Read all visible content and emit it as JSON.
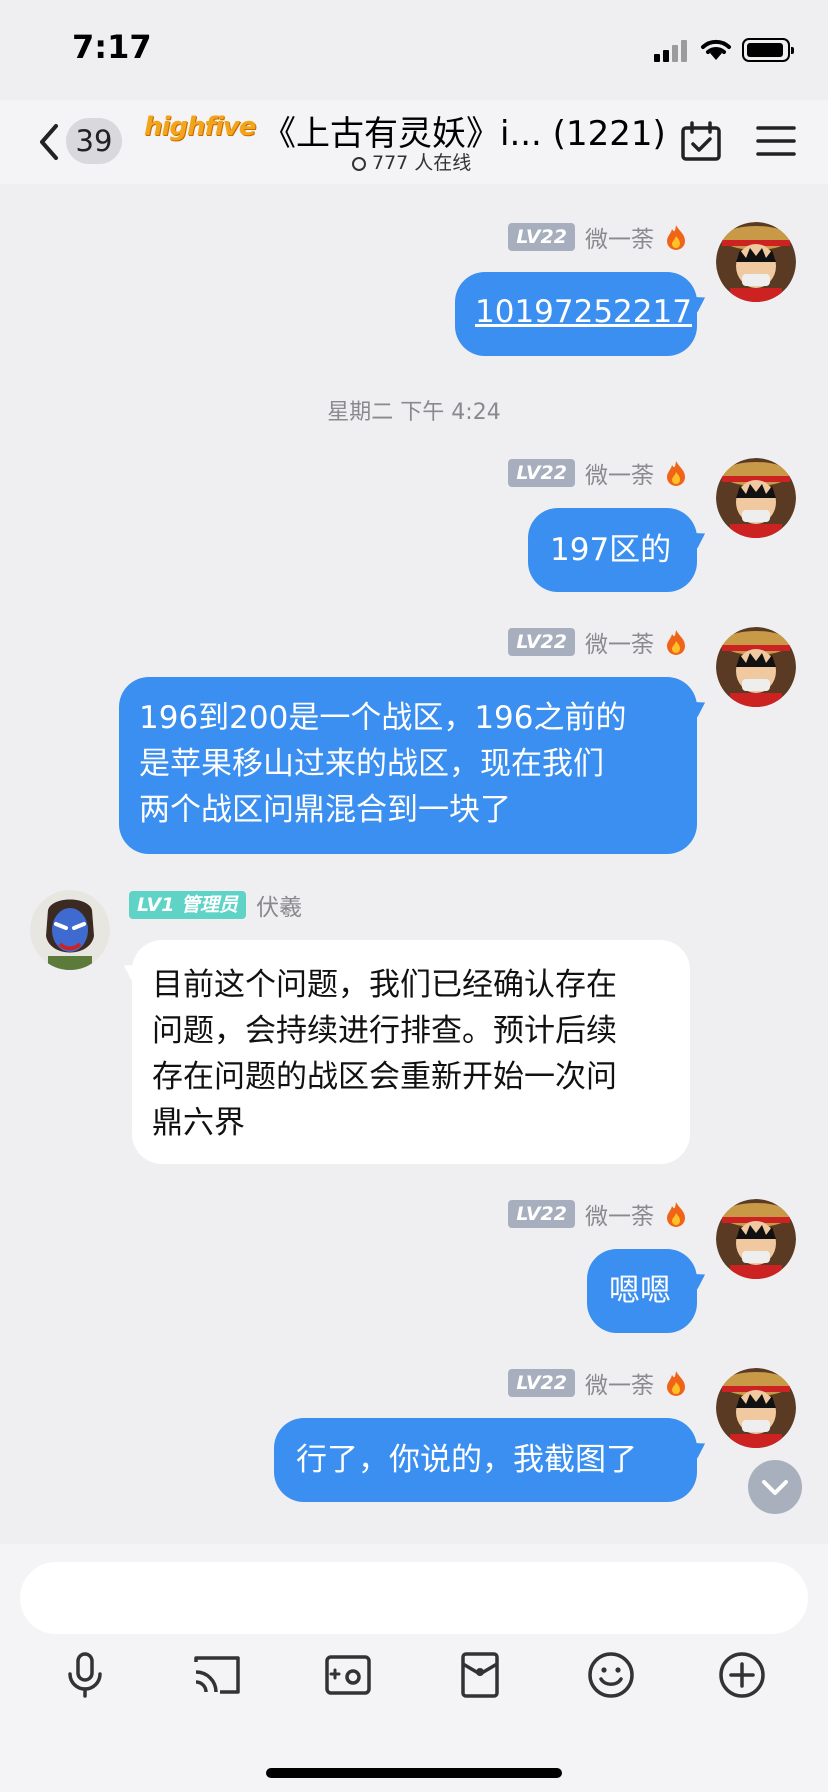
{
  "status_bar": {
    "time": "7:17"
  },
  "header": {
    "back_count": "39",
    "logo_text": "highfive",
    "title": "《上古有灵妖》i... (1221)",
    "online": "777 人在线"
  },
  "timestamp": "星期二 下午 4:24",
  "messages": [
    {
      "level": "LV22",
      "name": "微一荼",
      "text": "10197252217"
    },
    {
      "level": "LV22",
      "name": "微一荼",
      "text": "197区的"
    },
    {
      "level": "LV22",
      "name": "微一荼",
      "lines": [
        "196到200是一个战区，196之前的",
        "是苹果移山过来的战区，现在我们",
        "两个战区问鼎混合到一块了"
      ]
    },
    {
      "level": "LV1",
      "role": "管理员",
      "name": "伏羲",
      "lines": [
        "目前这个问题，我们已经确认存在",
        "问题，会持续进行排查。预计后续",
        "存在问题的战区会重新开始一次问",
        "鼎六界"
      ]
    },
    {
      "level": "LV22",
      "name": "微一荼",
      "text": "嗯嗯"
    },
    {
      "level": "LV22",
      "name": "微一荼",
      "text": "行了，你说的，我截图了"
    }
  ],
  "input": {
    "placeholder": ""
  },
  "icons": {
    "back": "chevron-left-icon",
    "calendar": "calendar-check-icon",
    "menu": "hamburger-menu-icon",
    "toolbar": [
      "microphone-icon",
      "cast-screen-icon",
      "photo-icon",
      "red-packet-icon",
      "emoji-icon",
      "plus-circle-icon"
    ]
  },
  "colors": {
    "my_bubble": "#3b8ff0",
    "other_bubble": "#ffffff",
    "background": "#efeff2",
    "admin_badge": "#5fd3c6"
  }
}
